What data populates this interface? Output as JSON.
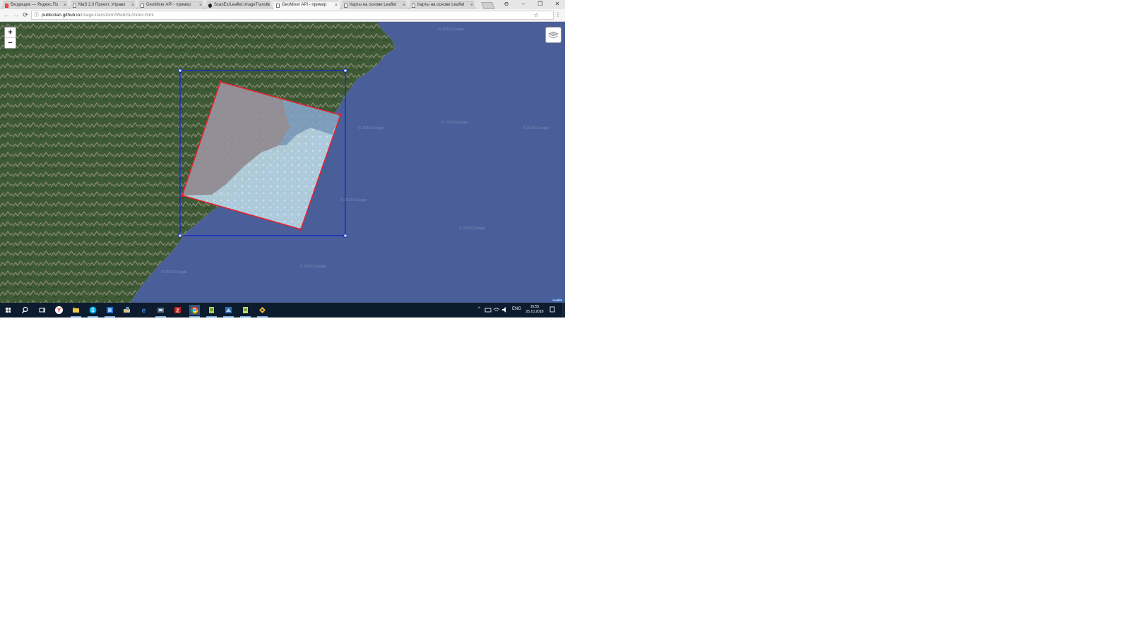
{
  "browser": {
    "tabs": [
      {
        "label": "Входящие — Яндекс.По",
        "icon": "yandex-mail-icon",
        "active": false
      },
      {
        "label": "MaS 2.0 Проект. Управл",
        "icon": "page-icon",
        "active": false
      },
      {
        "label": "GeoMixer API - пример",
        "icon": "page-icon",
        "active": false
      },
      {
        "label": "ScanEx/Leaflet.ImageTransfo",
        "icon": "github-icon",
        "active": false
      },
      {
        "label": "GeoMixer API - пример",
        "icon": "page-icon",
        "active": true
      },
      {
        "label": "Карты на основе Leaflet",
        "icon": "page-icon",
        "active": false
      },
      {
        "label": "Карты на основе Leaflet",
        "icon": "page-icon",
        "active": false
      }
    ],
    "close_glyph": "×",
    "window_controls": {
      "profile": "⊖",
      "minimize": "–",
      "restore": "❐",
      "close": "✕"
    },
    "nav": {
      "back": "←",
      "forward": "→",
      "reload": "⟳",
      "info": "ⓘ"
    },
    "url": {
      "host": "publicdan.github.io",
      "path": "/image-transform/WebGL/index.html"
    },
    "star": "☆",
    "menu": "⋮"
  },
  "map": {
    "zoom_in": "+",
    "zoom_out": "−",
    "attribution": "Leaflet",
    "watermark": "© 2018 Google",
    "colors": {
      "sea": "#4a5f99",
      "land": "#3d5a34",
      "bbox": "#1b2fbf",
      "polygon": "#e8202a"
    }
  },
  "taskbar": {
    "icons": [
      "windows-start-icon",
      "search-icon",
      "task-view-icon",
      "yandex-browser-icon",
      "file-explorer-icon",
      "skype-icon",
      "app-icon",
      "folder-app-icon",
      "edge-icon",
      "app-icon-2",
      "filezilla-icon",
      "chrome-icon",
      "notepad-icon",
      "app-icon-3",
      "notepad-icon-2",
      "app-icon-4"
    ],
    "tray": {
      "chevron": "^",
      "lang": "ENG"
    },
    "clock": {
      "time": "16:55",
      "date": "25.10.2018"
    }
  }
}
